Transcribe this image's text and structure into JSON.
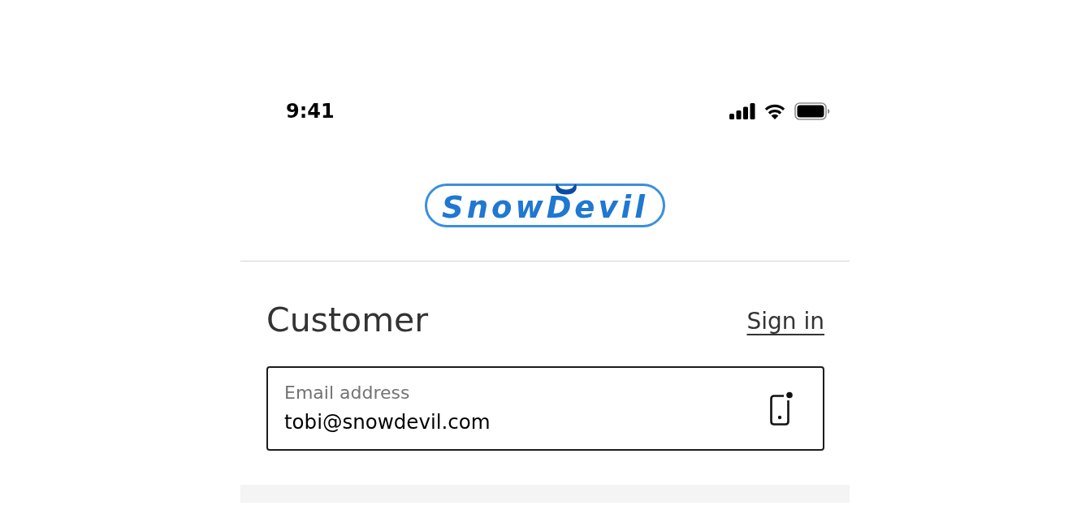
{
  "status_bar": {
    "time": "9:41"
  },
  "header": {
    "logo": {
      "text": "SnowDevil"
    }
  },
  "customer_section": {
    "title": "Customer",
    "sign_in_link": "Sign in",
    "email_field": {
      "label": "Email address",
      "value": "tobi@snowdevil.com"
    }
  }
}
